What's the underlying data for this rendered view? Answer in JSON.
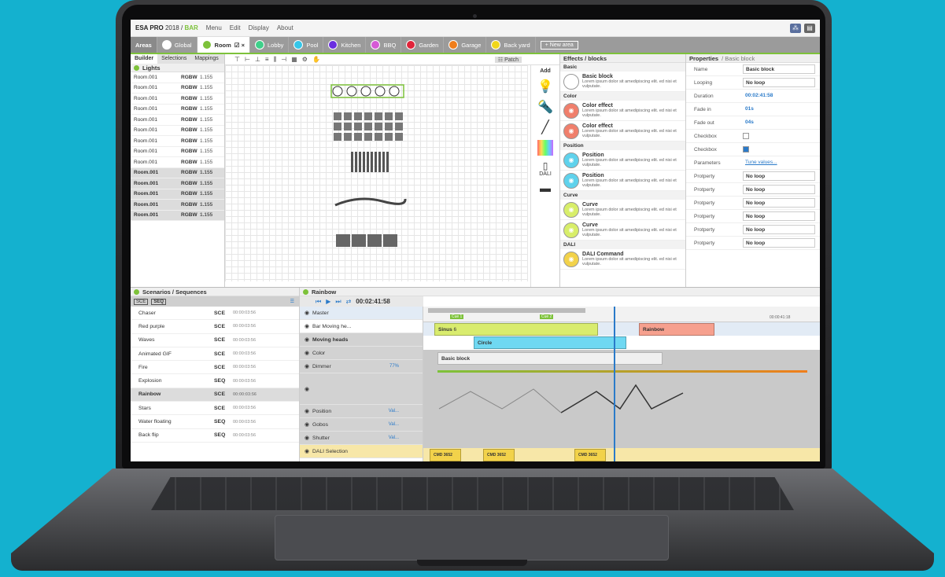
{
  "app": {
    "brand": "ESA PRO",
    "year": "2018 /",
    "product": "BAR"
  },
  "menu": [
    "Menu",
    "Edit",
    "Display",
    "About"
  ],
  "areas": {
    "label": "Areas",
    "items": [
      {
        "label": "Global",
        "color": "#ffffff"
      },
      {
        "label": "Room",
        "color": "#7dc23a",
        "active": true,
        "suffix": "☑ ×"
      },
      {
        "label": "Lobby",
        "color": "#3fd08a"
      },
      {
        "label": "Pool",
        "color": "#35c6e8"
      },
      {
        "label": "Kitchen",
        "color": "#6a2ee0"
      },
      {
        "label": "BBQ",
        "color": "#d65ad6"
      },
      {
        "label": "Garden",
        "color": "#e0243a"
      },
      {
        "label": "Garage",
        "color": "#f07e1b"
      },
      {
        "label": "Back yard",
        "color": "#f0d61b"
      }
    ],
    "new_area": "+ New area"
  },
  "left_panel": {
    "tabs": [
      "Builder",
      "Selections",
      "Mappings"
    ],
    "title": "Lights",
    "lights": [
      {
        "name": "Room.001",
        "type": "RGBW",
        "val": "1.155"
      },
      {
        "name": "Room.001",
        "type": "RGBW",
        "val": "1.155"
      },
      {
        "name": "Room.001",
        "type": "RGBW",
        "val": "1.155"
      },
      {
        "name": "Room.001",
        "type": "RGBW",
        "val": "1.155"
      },
      {
        "name": "Room.001",
        "type": "RGBW",
        "val": "1.155"
      },
      {
        "name": "Room.001",
        "type": "RGBW",
        "val": "1.155"
      },
      {
        "name": "Room.001",
        "type": "RGBW",
        "val": "1.155"
      },
      {
        "name": "Room.001",
        "type": "RGBW",
        "val": "1.155"
      },
      {
        "name": "Room.001",
        "type": "RGBW",
        "val": "1.155"
      },
      {
        "name": "Room.001",
        "type": "RGBW",
        "val": "1.155",
        "dark": true
      },
      {
        "name": "Room.001",
        "type": "RGBW",
        "val": "1.155",
        "dark": true
      },
      {
        "name": "Room.001",
        "type": "RGBW",
        "val": "1.155",
        "dark": true
      },
      {
        "name": "Room.001",
        "type": "RGBW",
        "val": "1.155",
        "dark": true
      },
      {
        "name": "Room.001",
        "type": "RGBW",
        "val": "1.155",
        "dark": true
      }
    ]
  },
  "canvas": {
    "patch_label": "Patch",
    "add_label": "Add",
    "dali_label": "DALI"
  },
  "effects": {
    "title": "Effects / blocks",
    "sections": [
      {
        "name": "Basic",
        "items": [
          {
            "title": "Basic block",
            "desc": "Lorem ipsum dolor sit amedipiscing elit. ed nisi et vulputate.",
            "color": "#ffffff",
            "icon": "sliders-icon"
          }
        ]
      },
      {
        "name": "Color",
        "items": [
          {
            "title": "Color effect",
            "desc": "Lorem ipsum dolor sit amedipiscing elit. ed nisi et vulputate.",
            "color": "#f07f6c",
            "icon": "palette-icon"
          },
          {
            "title": "Color effect",
            "desc": "Lorem ipsum dolor sit amedipiscing elit. ed nisi et vulputate.",
            "color": "#f07f6c",
            "icon": "palette-icon"
          }
        ]
      },
      {
        "name": "Position",
        "items": [
          {
            "title": "Position",
            "desc": "Lorem ipsum dolor sit amedipiscing elit. ed nisi et vulputate.",
            "color": "#5fd2ec",
            "icon": "target-icon"
          },
          {
            "title": "Position",
            "desc": "Lorem ipsum dolor sit amedipiscing elit. ed nisi et vulputate.",
            "color": "#5fd2ec",
            "icon": "target-icon"
          }
        ]
      },
      {
        "name": "Curve",
        "items": [
          {
            "title": "Curve",
            "desc": "Lorem ipsum dolor sit amedipiscing elit. ed nisi et vulputate.",
            "color": "#d8ee6a",
            "icon": "wave-icon"
          },
          {
            "title": "Curve",
            "desc": "Lorem ipsum dolor sit amedipiscing elit. ed nisi et vulputate.",
            "color": "#d8ee6a",
            "icon": "wave-icon"
          }
        ]
      },
      {
        "name": "DALI",
        "items": [
          {
            "title": "DALI Command",
            "desc": "Lorem ipsum dolor sit amedipiscing elit. ed nisi et vulputate.",
            "color": "#f2d24a",
            "icon": "dali-icon"
          }
        ]
      }
    ]
  },
  "properties": {
    "title": "Properties",
    "subtitle": "/ Basic block",
    "rows": [
      {
        "key": "Name",
        "value": "Basic block",
        "kind": "box"
      },
      {
        "key": "Looping",
        "value": "No loop",
        "kind": "select"
      },
      {
        "key": "Duration",
        "value": "00:02:41:58",
        "kind": "blue"
      },
      {
        "key": "Fade in",
        "value": "01s",
        "kind": "blue"
      },
      {
        "key": "Fade out",
        "value": "04s",
        "kind": "slider",
        "min": "0s",
        "max": "60s"
      },
      {
        "key": "Checkbox",
        "value": "",
        "kind": "check-off"
      },
      {
        "key": "Checkbox",
        "value": "",
        "kind": "check-on"
      },
      {
        "key": "Parameters",
        "value": "Tune values...",
        "kind": "link"
      },
      {
        "key": "Protperty",
        "value": "No loop",
        "kind": "select"
      },
      {
        "key": "Protperty",
        "value": "No loop",
        "kind": "select"
      },
      {
        "key": "Protperty",
        "value": "No loop",
        "kind": "select"
      },
      {
        "key": "Protperty",
        "value": "No loop",
        "kind": "select"
      },
      {
        "key": "Protperty",
        "value": "No loop",
        "kind": "select"
      },
      {
        "key": "Protperty",
        "value": "No loop",
        "kind": "select"
      }
    ]
  },
  "scenarios": {
    "title": "Scenarios / Sequences",
    "filters": [
      "SCE",
      "SEQ"
    ],
    "rows": [
      {
        "name": "Chaser",
        "type": "SCE",
        "time": "00:00:03:56"
      },
      {
        "name": "Red purple",
        "type": "SCE",
        "time": "00:00:03:56"
      },
      {
        "name": "Waves",
        "type": "SCE",
        "time": "00:00:03:56"
      },
      {
        "name": "Animated GIF",
        "type": "SCE",
        "time": "00:00:03:56"
      },
      {
        "name": "Fire",
        "type": "SCE",
        "time": "00:00:03:56"
      },
      {
        "name": "Explosion",
        "type": "SEQ",
        "time": "00:00:03:56"
      },
      {
        "name": "Rainbow",
        "type": "SCE",
        "time": "00:00:03:56",
        "selected": true
      },
      {
        "name": "Stars",
        "type": "SCE",
        "time": "00:00:03:56"
      },
      {
        "name": "Water floating",
        "type": "SEQ",
        "time": "00:00:03:56"
      },
      {
        "name": "Back flip",
        "type": "SEQ",
        "time": "00:00:03:56"
      }
    ]
  },
  "sequencer": {
    "title": "Rainbow",
    "timecode": "00:02:41:58",
    "tracks": [
      {
        "label": "Master",
        "style": "blue"
      },
      {
        "label": "Bar Moving he...",
        "style": "white"
      },
      {
        "label": "Moving heads",
        "style": "gray-bold"
      },
      {
        "label": "Color",
        "style": "gray"
      },
      {
        "label": "Dimmer",
        "style": "gray",
        "value": "77%"
      },
      {
        "label": "",
        "style": "gray-tall"
      },
      {
        "label": "Position",
        "style": "gray",
        "value": "Val..."
      },
      {
        "label": "Gobos",
        "style": "gray",
        "value": "Val..."
      },
      {
        "label": "Shutter",
        "style": "gray",
        "value": "Val..."
      },
      {
        "label": "DALI Selection",
        "style": "yellow"
      }
    ],
    "cues": [
      "Cue 1",
      "Cue 2"
    ],
    "blocks": {
      "sinus": "Sinus",
      "sinus_count": "6",
      "rainbow": "Rainbow",
      "circle": "Circle",
      "basic": "Basic block",
      "dali_cmd": "DALI",
      "dali_cmd_sub": "CMD 3652"
    },
    "dimmer_points": [
      "60%",
      "20%",
      "60%",
      "10%",
      "40%"
    ],
    "ruler_time": "00:00:41:18"
  }
}
